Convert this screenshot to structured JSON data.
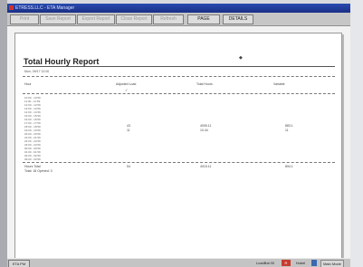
{
  "window": {
    "title": "ETRESS.LLC - ETA Manager"
  },
  "toolbar": {
    "buttons": [
      {
        "label": "Print",
        "enabled": false
      },
      {
        "label": "Save Report",
        "enabled": false
      },
      {
        "label": "Export Report",
        "enabled": false
      },
      {
        "label": "Close Report",
        "enabled": false
      },
      {
        "label": "Refresh",
        "enabled": false
      },
      {
        "label": "PAGE",
        "enabled": true
      },
      {
        "label": "DETAILS",
        "enabled": true
      }
    ]
  },
  "report": {
    "title": "Total Hourly Report",
    "title_mark": "◆",
    "date_line": "Mon, 09/17 12:00",
    "columns": {
      "hour": "Hour",
      "col1": "Adjusted Load",
      "col2": "Total Hours",
      "col3": "Variable"
    },
    "column_mark": "✓",
    "hours": [
      "10:00 - 10:59",
      "11:00 - 11:59",
      "12:00 - 12:59",
      "13:00 - 13:59",
      "14:00 - 14:59",
      "15:00 - 15:59",
      "16:00 - 16:59",
      "17:00 - 17:59",
      "18:00 - 18:59",
      "19:00 - 19:59",
      "20:00 - 20:59",
      "21:00 - 21:59",
      "22:00 - 22:59",
      "23:00 - 23:59",
      "00:00 - 00:59",
      "01:00 - 01:59",
      "02:00 - 02:59",
      "03:00 - 03:59"
    ],
    "values": {
      "col1": [
        "43",
        "11"
      ],
      "col2": [
        "4005.11",
        "10.44"
      ],
      "col3": [
        "883.1",
        "11"
      ]
    },
    "total": {
      "label": "Hours Total",
      "col1": "54",
      "col2": "4015.11",
      "col3": "894.1"
    },
    "total_sub": "Total: 18 Opened: 3"
  },
  "taskbar": {
    "start": "ETA PM",
    "item_a": "LoadBal 00",
    "item_b": "R",
    "item_c": "Hubel",
    "item_d": "",
    "item_e": "Main Mode"
  }
}
